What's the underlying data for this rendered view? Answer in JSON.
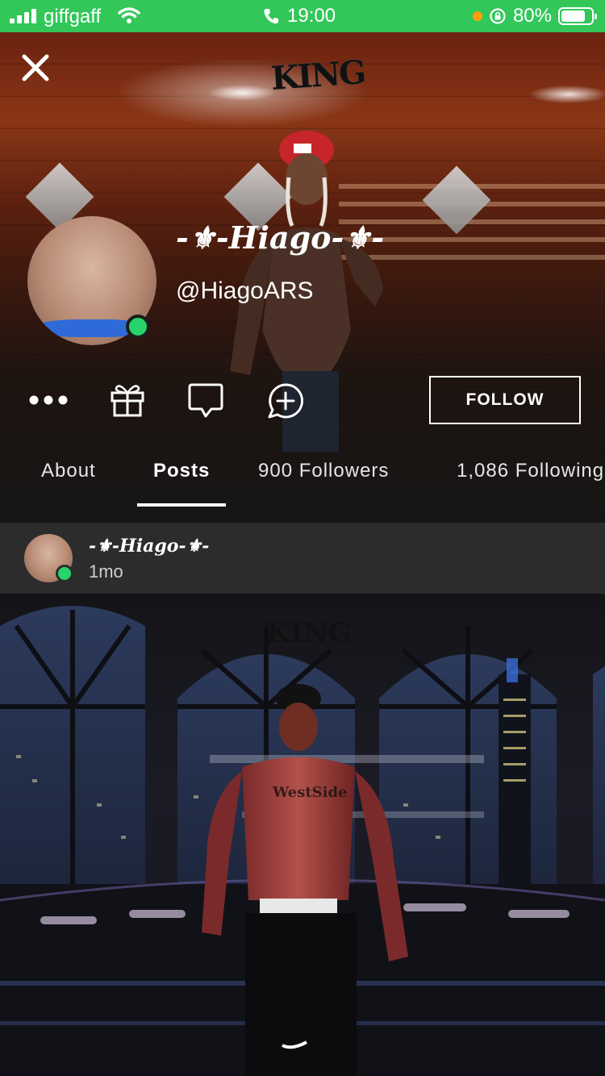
{
  "status_bar": {
    "carrier": "giffgaff",
    "time": "19:00",
    "battery": "80%",
    "battery_level": 0.8,
    "color": "#33c75a"
  },
  "header": {
    "close_icon": "close-icon",
    "king_logo": "KING"
  },
  "profile": {
    "display_name": "-⚜-Hiago-⚜-",
    "handle": "@HiagoARS",
    "online": true,
    "online_color": "#27d36b"
  },
  "actions": {
    "more_icon": "more-icon",
    "gift_icon": "gift-icon",
    "message_icon": "message-icon",
    "add_chat_icon": "add-chat-icon",
    "follow_label": "FOLLOW"
  },
  "tabs": [
    {
      "label": "About"
    },
    {
      "label": "Posts",
      "active": true
    },
    {
      "label": "900 Followers"
    },
    {
      "label": "1,086 Following"
    }
  ],
  "post": {
    "author": "-⚜-Hiago-⚜-",
    "time": "1mo"
  }
}
